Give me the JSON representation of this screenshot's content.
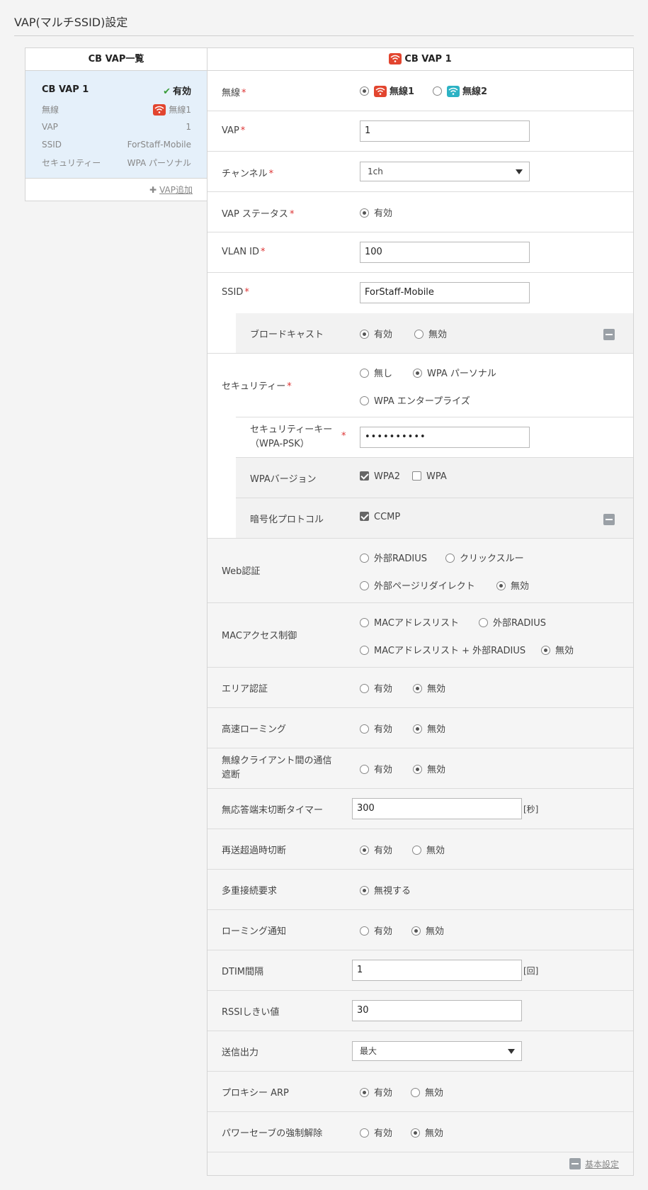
{
  "page": {
    "title": "VAP(マルチSSID)設定"
  },
  "list": {
    "header": "CB VAP一覧",
    "card": {
      "name": "CB VAP 1",
      "status": "有効",
      "rows": [
        {
          "label": "無線",
          "value": "無線1"
        },
        {
          "label": "VAP",
          "value": "1"
        },
        {
          "label": "SSID",
          "value": "ForStaff-Mobile"
        },
        {
          "label": "セキュリティー",
          "value": "WPA パーソナル"
        }
      ]
    },
    "add_label": "VAP追加"
  },
  "form": {
    "header": "CB VAP 1",
    "required_mark": "*",
    "radio_label": "無線",
    "radio_opt1": "無線1",
    "radio_opt2": "無線2",
    "vap_label": "VAP",
    "vap_value": "1",
    "channel_label": "チャンネル",
    "channel_value": "1ch",
    "vap_status_label": "VAP ステータス",
    "vap_status_opt": "有効",
    "vlan_label": "VLAN ID",
    "vlan_value": "100",
    "ssid_label": "SSID",
    "ssid_value": "ForStaff-Mobile",
    "broadcast_label": "ブロードキャスト",
    "broadcast_on": "有効",
    "broadcast_off": "無効",
    "security_label": "セキュリティー",
    "sec_none": "無し",
    "sec_wpa_personal": "WPA パーソナル",
    "sec_wpa_enterprise": "WPA エンタープライズ",
    "seckey_label1": "セキュリティーキー",
    "seckey_label2": "（WPA-PSK）",
    "seckey_value": "••••••••••",
    "wpa_version_label": "WPAバージョン",
    "wpa2": "WPA2",
    "wpa": "WPA",
    "encrypt_label": "暗号化プロトコル",
    "ccmp": "CCMP",
    "web_auth_label": "Web認証",
    "web_ext_radius": "外部RADIUS",
    "web_click_through": "クリックスルー",
    "web_ext_redirect": "外部ページリダイレクト",
    "web_disabled": "無効",
    "mac_label": "MACアクセス制御",
    "mac_list": "MACアドレスリスト",
    "mac_ext_radius": "外部RADIUS",
    "mac_list_radius": "MACアドレスリスト + 外部RADIUS",
    "mac_disabled": "無効",
    "area_label": "エリア認証",
    "fast_roam_label": "高速ローミング",
    "client_iso_label1": "無線クライアント間の通信",
    "client_iso_label2": "遮断",
    "enabled": "有効",
    "disabled": "無効",
    "idle_timer_label": "無応答端末切断タイマー",
    "idle_timer_value": "300",
    "idle_timer_unit": "[秒]",
    "retry_label": "再送超過時切断",
    "multi_conn_label": "多重接続要求",
    "multi_conn_opt": "無視する",
    "roam_notify_label": "ローミング通知",
    "dtim_label": "DTIM間隔",
    "dtim_value": "1",
    "dtim_unit": "[回]",
    "rssi_label": "RSSIしきい値",
    "rssi_value": "30",
    "tx_power_label": "送信出力",
    "tx_power_value": "最大",
    "proxy_arp_label": "プロキシー ARP",
    "power_save_label": "パワーセーブの強制解除",
    "basic_settings": "基本設定"
  }
}
